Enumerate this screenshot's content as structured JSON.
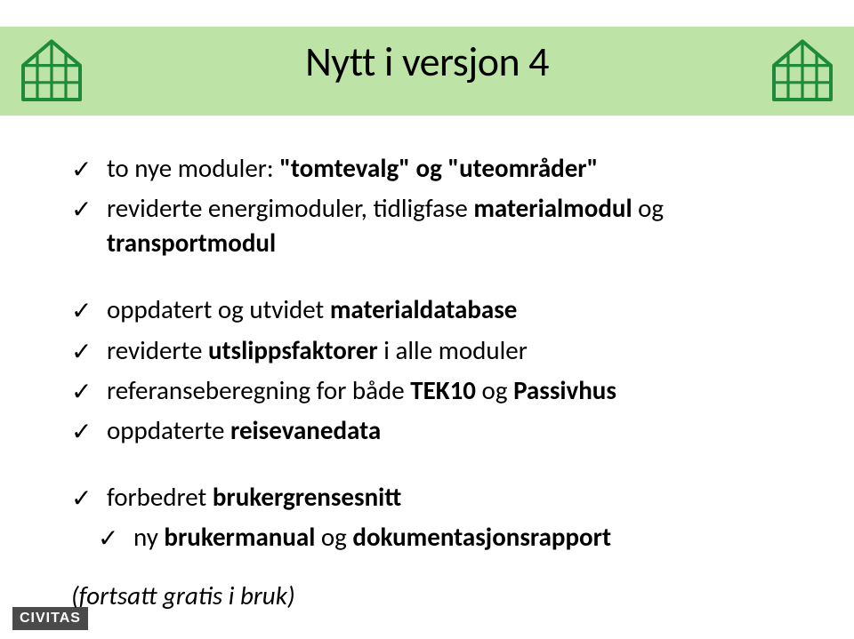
{
  "title": "Nytt i versjon 4",
  "bullets": {
    "b1_prefix": "to nye moduler: ",
    "b1_bold": "\"tomtevalg\" og \"uteområder\"",
    "b2_prefix": "reviderte energimoduler, tidligfase ",
    "b2_bold1": "materialmodul",
    "b2_mid": " og ",
    "b2_bold2": "transportmodul",
    "b3_prefix": "oppdatert og utvidet ",
    "b3_bold": "materialdatabase",
    "b4_prefix": "reviderte ",
    "b4_bold": "utslippsfaktorer",
    "b4_suffix": " i alle moduler",
    "b5_prefix": "referanseberegning for både ",
    "b5_bold1": "TEK10",
    "b5_mid": " og ",
    "b5_bold2": "Passivhus",
    "b6_prefix": "oppdaterte ",
    "b6_bold": "reisevanedata",
    "b7_prefix": "forbedret ",
    "b7_bold": "brukergrensesnitt",
    "b8_prefix": "ny ",
    "b8_bold1": "brukermanual",
    "b8_mid": " og ",
    "b8_bold2": "dokumentasjonsrapport"
  },
  "footnote": "(fortsatt gratis i bruk)",
  "logo": "CIVITAS",
  "checkmark": "✓",
  "colors": {
    "stripe": "#bee3a6",
    "house_outline": "#1e8a3b",
    "house_fill": "#bee3a6",
    "logo_bg": "#4a4a4a"
  }
}
